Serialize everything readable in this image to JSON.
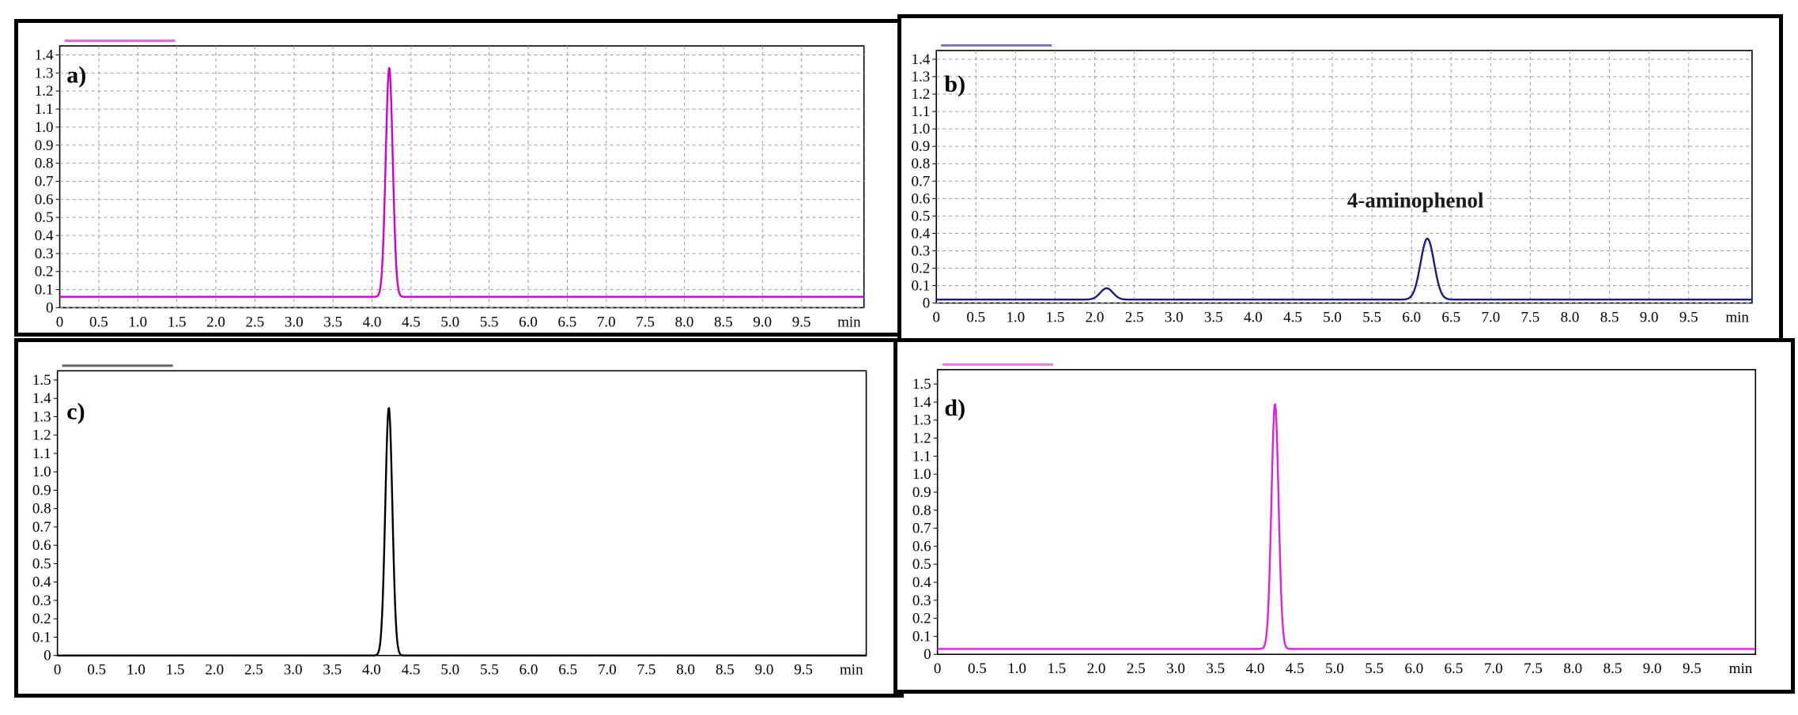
{
  "chart_data": [
    {
      "type": "line",
      "panel_label": "a)",
      "x_unit": "min",
      "xlim": [
        0,
        10.3
      ],
      "ylim": [
        0,
        1.45
      ],
      "x_ticks": [
        "0",
        "0.5",
        "1.0",
        "1.5",
        "2.0",
        "2.5",
        "3.0",
        "3.5",
        "4.0",
        "4.5",
        "5.0",
        "5.5",
        "6.0",
        "6.5",
        "7.0",
        "7.5",
        "8.0",
        "8.5",
        "9.0",
        "9.5"
      ],
      "y_ticks": [
        "0",
        "0.1",
        "0.2",
        "0.3",
        "0.4",
        "0.5",
        "0.6",
        "0.7",
        "0.8",
        "0.9",
        "1.0",
        "1.1",
        "1.2",
        "1.3",
        "1.4"
      ],
      "grid": true,
      "color": "#d000d0",
      "baseline": 0.06,
      "peaks": [
        {
          "rt": 4.22,
          "height": 1.27,
          "width": 0.045
        }
      ],
      "annotations": []
    },
    {
      "type": "line",
      "panel_label": "b)",
      "x_unit": "min",
      "xlim": [
        0,
        10.3
      ],
      "ylim": [
        0,
        1.45
      ],
      "x_ticks": [
        "0",
        "0.5",
        "1.0",
        "1.5",
        "2.0",
        "2.5",
        "3.0",
        "3.5",
        "4.0",
        "4.5",
        "5.0",
        "5.5",
        "6.0",
        "6.5",
        "7.0",
        "7.5",
        "8.0",
        "8.5",
        "9.0",
        "9.5"
      ],
      "y_ticks": [
        "0",
        "0.1",
        "0.2",
        "0.3",
        "0.4",
        "0.5",
        "0.6",
        "0.7",
        "0.8",
        "0.9",
        "1.0",
        "1.1",
        "1.2",
        "1.3",
        "1.4"
      ],
      "grid": true,
      "color": "#1a1a8c",
      "baseline": 0.02,
      "peaks": [
        {
          "rt": 2.15,
          "height": 0.065,
          "width": 0.08
        },
        {
          "rt": 6.2,
          "height": 0.35,
          "width": 0.085
        }
      ],
      "annotations": [
        {
          "text": "4-aminophenol",
          "x": 6.05,
          "y": 0.55
        }
      ]
    },
    {
      "type": "line",
      "panel_label": "c)",
      "x_unit": "min",
      "xlim": [
        0,
        10.3
      ],
      "ylim": [
        0,
        1.55
      ],
      "x_ticks": [
        "0",
        "0.5",
        "1.0",
        "1.5",
        "2.0",
        "2.5",
        "3.0",
        "3.5",
        "4.0",
        "4.5",
        "5.0",
        "5.5",
        "6.0",
        "6.5",
        "7.0",
        "7.5",
        "8.0",
        "8.5",
        "9.0",
        "9.5"
      ],
      "y_ticks": [
        "0",
        "0.1",
        "0.2",
        "0.3",
        "0.4",
        "0.5",
        "0.6",
        "0.7",
        "0.8",
        "0.9",
        "1.0",
        "1.1",
        "1.2",
        "1.3",
        "1.4",
        "1.5"
      ],
      "grid": false,
      "color": "#000000",
      "baseline": 0.0,
      "peaks": [
        {
          "rt": 4.22,
          "height": 1.35,
          "width": 0.045
        }
      ],
      "annotations": []
    },
    {
      "type": "line",
      "panel_label": "d)",
      "x_unit": "min",
      "xlim": [
        0,
        10.3
      ],
      "ylim": [
        0,
        1.58
      ],
      "x_ticks": [
        "0",
        "0.5",
        "1.0",
        "1.5",
        "2.0",
        "2.5",
        "3.0",
        "3.5",
        "4.0",
        "4.5",
        "5.0",
        "5.5",
        "6.0",
        "6.5",
        "7.0",
        "7.5",
        "8.0",
        "8.5",
        "9.0",
        "9.5"
      ],
      "y_ticks": [
        "0",
        "0.1",
        "0.2",
        "0.3",
        "0.4",
        "0.5",
        "0.6",
        "0.7",
        "0.8",
        "0.9",
        "1.0",
        "1.1",
        "1.2",
        "1.3",
        "1.4",
        "1.5"
      ],
      "grid": false,
      "color": "#e020e0",
      "baseline": 0.03,
      "peaks": [
        {
          "rt": 4.25,
          "height": 1.36,
          "width": 0.045
        }
      ],
      "annotations": []
    }
  ]
}
